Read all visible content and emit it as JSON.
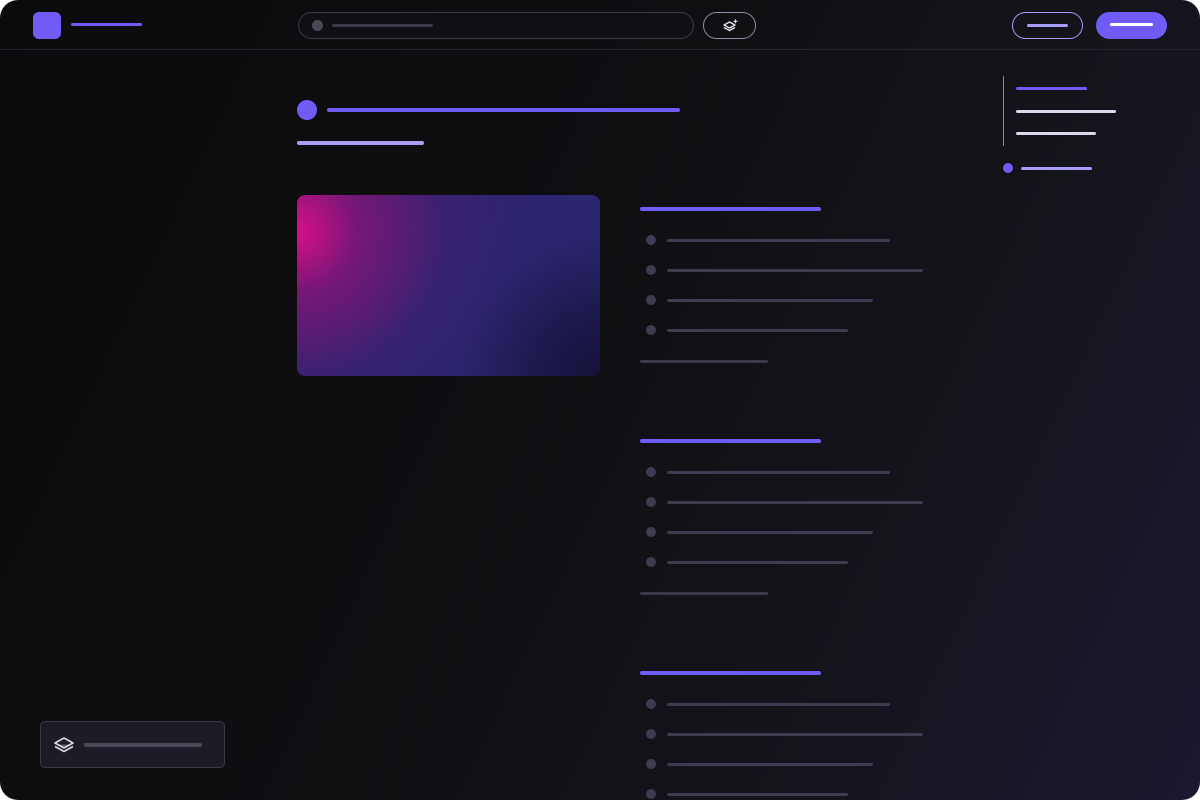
{
  "header": {
    "logo_icon": "app-logo-icon",
    "search_icon": "search-icon",
    "ai_icon": "sparkle-layers-icon"
  },
  "colors": {
    "accent": "#6f5cf6",
    "accent_light": "#a79cff",
    "muted": "#3e3c50",
    "hero_pink": "#d80e8a",
    "hero_indigo": "#2d2572"
  },
  "widget": {
    "icon": "layers-icon"
  }
}
